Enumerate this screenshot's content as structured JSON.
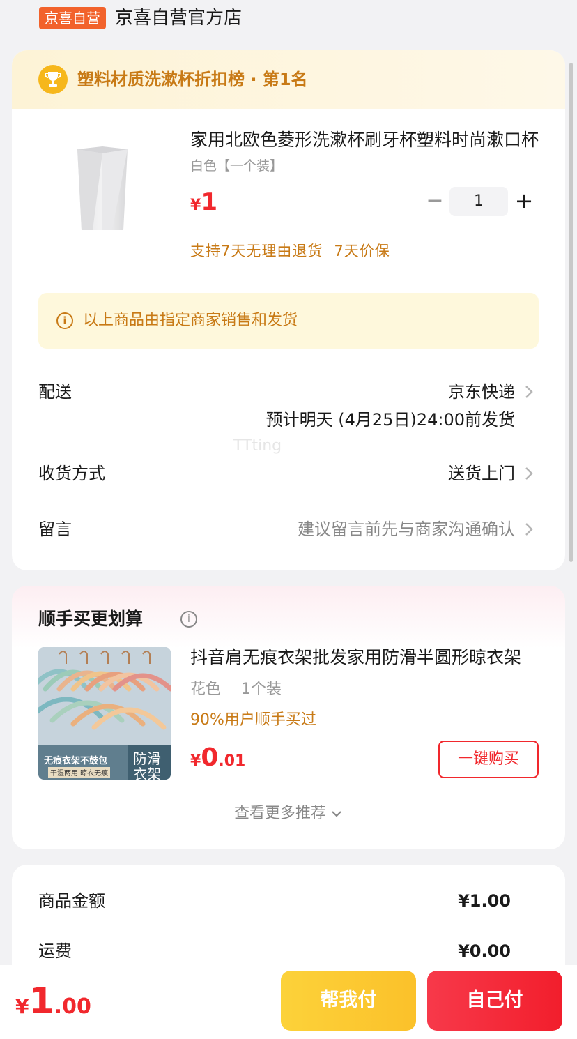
{
  "store": {
    "badge": "京喜自营",
    "name": "京喜自营官方店"
  },
  "rank": {
    "icon": "trophy-icon",
    "text": "塑料材质洗漱杯折扣榜 · 第1名"
  },
  "product": {
    "title": "家用北欧色菱形洗漱杯刷牙杯塑料时尚漱口杯",
    "spec": "白色【一个装】",
    "price_symbol": "¥",
    "price_int": "1",
    "quantity": "1",
    "minus": "−",
    "plus": "+",
    "services": [
      "支持7天无理由退货",
      "7天价保"
    ]
  },
  "notice": {
    "icon": "info-icon",
    "icon_glyph": "i",
    "text": "以上商品由指定商家销售和发货"
  },
  "delivery": {
    "label": "配送",
    "carrier": "京东快递",
    "eta": "预计明天 (4月25日)24:00前发货"
  },
  "receive": {
    "label": "收货方式",
    "value": "送货上门"
  },
  "message": {
    "label": "留言",
    "placeholder": "建议留言前先与商家沟通确认"
  },
  "watermark": "TTting",
  "recommend": {
    "title": "顺手买更划算",
    "info_glyph": "i",
    "product_title": "抖音肩无痕衣架批发家用防滑半圆形晾衣架",
    "spec_color": "花色",
    "spec_pack": "1个装",
    "tag": "90%用户顺手买过",
    "price_symbol": "¥",
    "price_int": "0",
    "price_dec": ".01",
    "buy_label": "一键购买",
    "image_text_main": "无痕衣架不鼓包",
    "image_text_sub": "干湿两用 晾衣无痕",
    "image_text_side_1": "防滑",
    "image_text_side_2": "衣架",
    "more_label": "查看更多推荐"
  },
  "summary": {
    "goods_label": "商品金额",
    "goods_value": "¥1.00",
    "shipping_label": "运费",
    "shipping_value": "¥0.00"
  },
  "bottom": {
    "total_symbol": "¥",
    "total_int": "1",
    "total_dec": ".00",
    "help_pay": "帮我付",
    "self_pay": "自己付"
  },
  "colors": {
    "accent_red": "#f1282d",
    "accent_orange": "#c87a16",
    "badge_orange": "#f2622b",
    "yellow": "#fcd23a"
  }
}
